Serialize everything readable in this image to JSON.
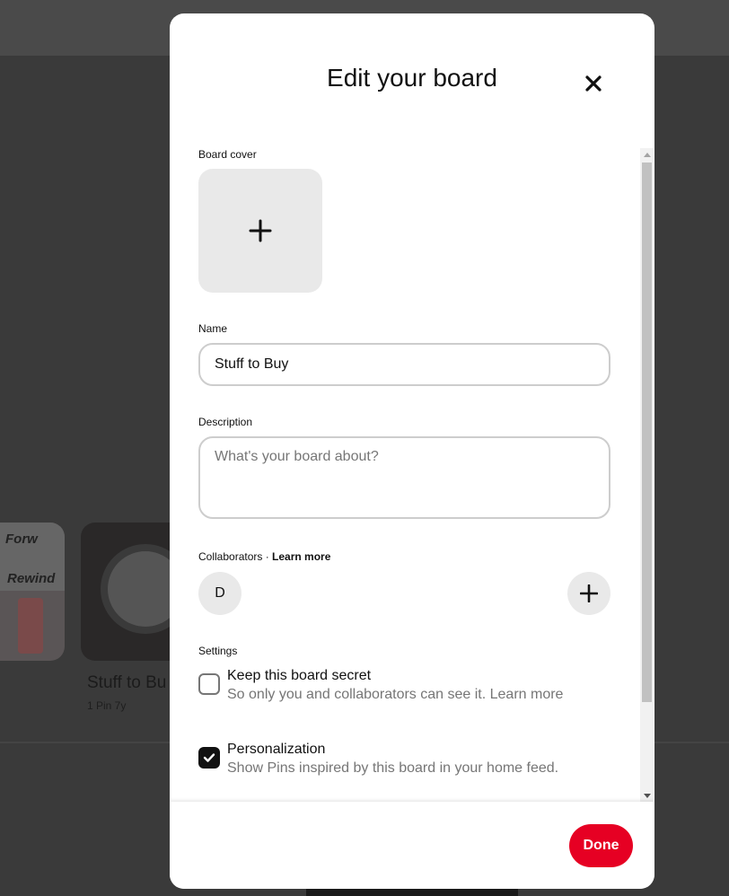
{
  "background": {
    "board_title": "Stuff to Bu",
    "board_meta": "1 Pin  7y",
    "thumb_text_1": "Forw",
    "thumb_text_2": "Rewind"
  },
  "modal": {
    "title": "Edit your board",
    "close_icon": "close-icon"
  },
  "form": {
    "cover_label": "Board cover",
    "cover_icon": "plus-icon",
    "name_label": "Name",
    "name_value": "Stuff to Buy",
    "description_label": "Description",
    "description_placeholder": "What's your board about?",
    "collaborators_label": "Collaborators · ",
    "learn_more": "Learn more",
    "collaborator_initial": "D",
    "settings_label": "Settings",
    "secret_title": "Keep this board secret",
    "secret_desc": "So only you and collaborators can see it. Learn more",
    "secret_checked": false,
    "personalization_title": "Personalization",
    "personalization_desc": "Show Pins inspired by this board in your home feed.",
    "personalization_checked": true
  },
  "footer": {
    "done_label": "Done"
  },
  "colors": {
    "accent": "#e60023",
    "overlay": "#3a3a3a",
    "field_border": "#cdcdcd",
    "muted_text": "#767676"
  }
}
